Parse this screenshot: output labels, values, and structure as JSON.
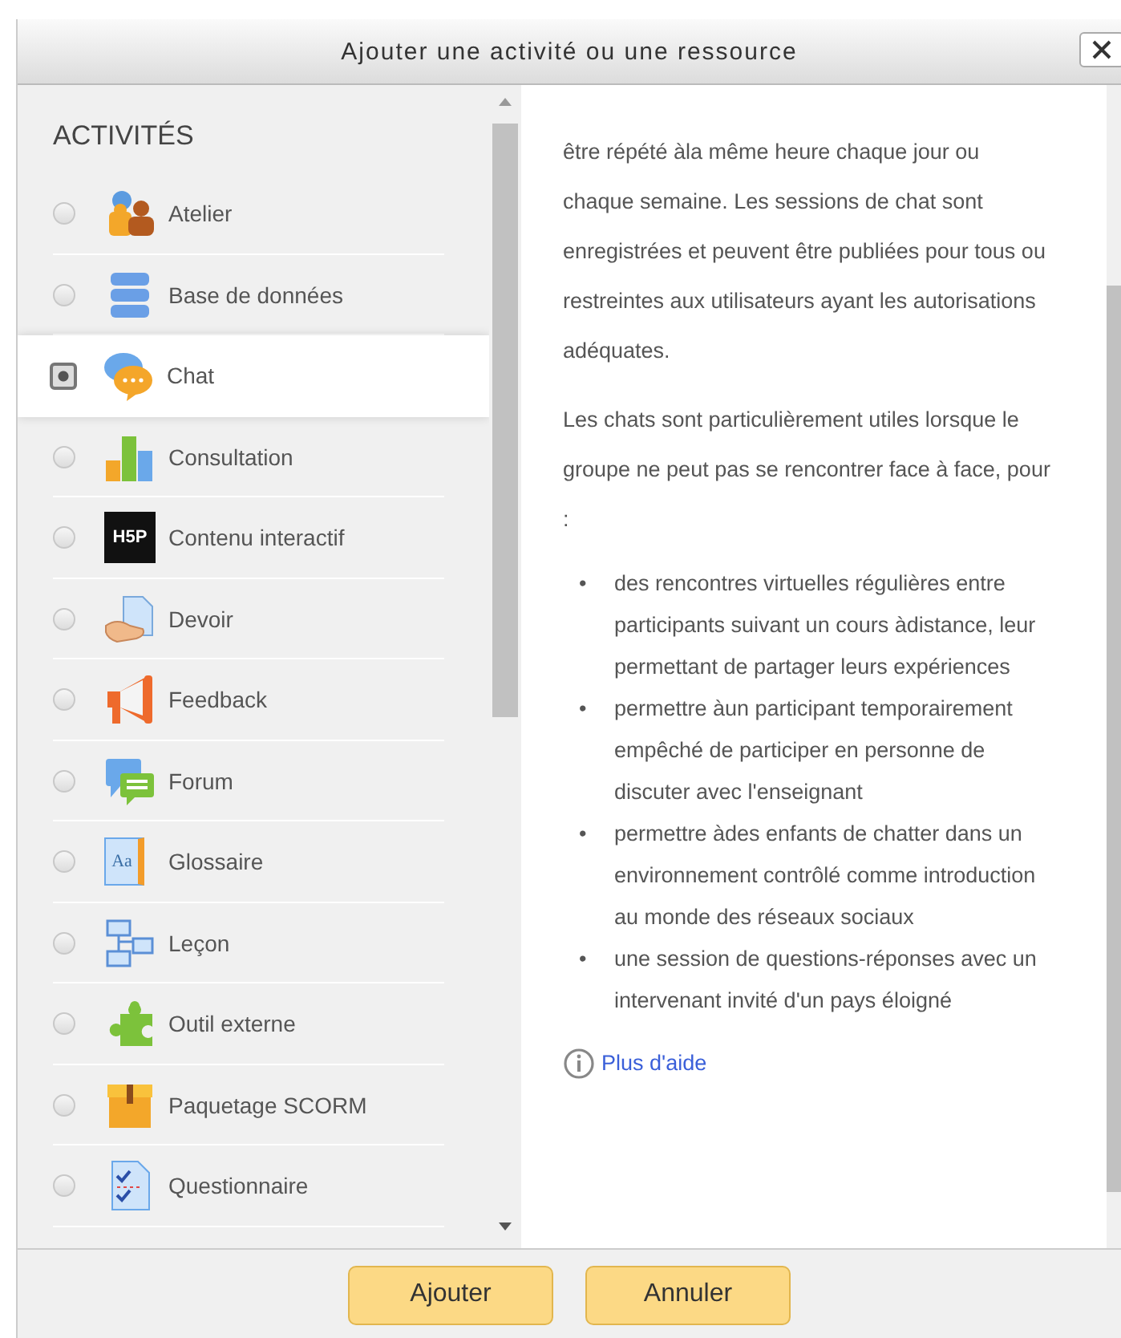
{
  "dialog": {
    "title": "Ajouter une activité ou une ressource"
  },
  "activities": {
    "heading": "ACTIVITÉS",
    "items": [
      {
        "label": "Atelier",
        "selected": false
      },
      {
        "label": "Base de données",
        "selected": false
      },
      {
        "label": "Chat",
        "selected": true
      },
      {
        "label": "Consultation",
        "selected": false
      },
      {
        "label": "Contenu interactif",
        "logo_text": "H5P",
        "selected": false
      },
      {
        "label": "Devoir",
        "selected": false
      },
      {
        "label": "Feedback",
        "selected": false
      },
      {
        "label": "Forum",
        "selected": false
      },
      {
        "label": "Glossaire",
        "logo_text": "Aa",
        "selected": false
      },
      {
        "label": "Leçon",
        "selected": false
      },
      {
        "label": "Outil externe",
        "selected": false
      },
      {
        "label": "Paquetage SCORM",
        "selected": false
      },
      {
        "label": "Questionnaire",
        "selected": false
      }
    ]
  },
  "help": {
    "paragraphs": [
      "être répété àla même heure chaque jour ou chaque semaine. Les sessions de chat sont enregistrées et peuvent être publiées pour tous ou restreintes aux utilisateurs ayant les autorisations adéquates.",
      "Les chats sont particulièrement utiles lorsque le groupe ne peut pas se rencontrer face à face, pour :"
    ],
    "bullets": [
      {
        "marker": "•",
        "text": "des rencontres virtuelles régulières entre participants suivant un cours àdistance, leur permettant de partager leurs expériences"
      },
      {
        "marker": "•",
        "text": "permettre àun participant temporairement empêché de participer en personne de discuter avec l'enseignant"
      },
      {
        "marker": "•",
        "text": "permettre àdes enfants de chatter dans un environnement contrôlé comme introduction au monde des réseaux sociaux"
      },
      {
        "marker": "•",
        "text": "une session de questions-réponses avec un intervenant invité d'un pays éloigné"
      }
    ],
    "link": "Plus d'aide"
  },
  "buttons": [
    "Ajouter",
    "Annuler"
  ]
}
